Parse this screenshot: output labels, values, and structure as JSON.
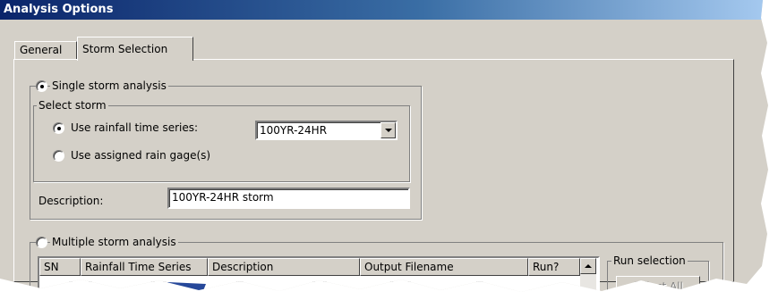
{
  "window": {
    "title": "Analysis Options"
  },
  "tabs": [
    {
      "label": "General",
      "active": false
    },
    {
      "label": "Storm Selection",
      "active": true
    }
  ],
  "single": {
    "label": "Single storm analysis",
    "selected": true,
    "select_storm": {
      "label": "Select storm",
      "use_rainfall": {
        "label": "Use rainfall time series:",
        "selected": true
      },
      "rainfall_value": "100YR-24HR",
      "use_gage": {
        "label": "Use assigned rain gage(s)",
        "selected": false
      }
    },
    "description_label": "Description:",
    "description_value": "100YR-24HR storm"
  },
  "multiple": {
    "label": "Multiple storm analysis",
    "selected": false,
    "columns": [
      "SN",
      "Rainfall Time Series",
      "Description",
      "Output Filename",
      "Run?"
    ],
    "run_selection": {
      "label": "Run selection",
      "select_all": "Select All"
    }
  },
  "colors": {
    "dialog_bg": "#d4d0c8",
    "title_start": "#0a246a",
    "title_end": "#a6caf0"
  }
}
